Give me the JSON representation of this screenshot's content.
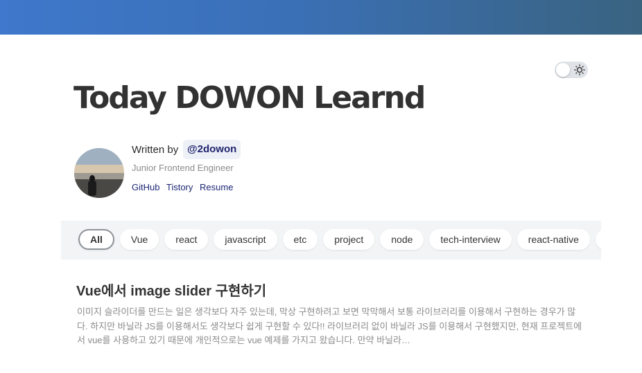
{
  "blog": {
    "title": "Today DOWON Learnd"
  },
  "author": {
    "written_by": "Written by",
    "handle": "@2dowon",
    "job": "Junior Frontend Engineer",
    "links": [
      {
        "label": "GitHub"
      },
      {
        "label": "Tistory"
      },
      {
        "label": "Resume"
      }
    ]
  },
  "theme_toggle": {
    "icon": "sun-icon",
    "state": "light"
  },
  "tags": [
    {
      "label": "All",
      "active": true
    },
    {
      "label": "Vue"
    },
    {
      "label": "react"
    },
    {
      "label": "javascript"
    },
    {
      "label": "etc"
    },
    {
      "label": "project"
    },
    {
      "label": "node"
    },
    {
      "label": "tech-interview"
    },
    {
      "label": "react-native"
    },
    {
      "label": ""
    }
  ],
  "posts": [
    {
      "title": "Vue에서 image slider 구현하기",
      "excerpt": "이미지 슬라이더를 만드는 일은 생각보다 자주 있는데, 막상 구현하려고 보면 막막해서 보통 라이브러리를 이용해서 구현하는 경우가 많다. 하지만 바닐라 JS를 이용해서도 생각보다 쉽게 구현할 수 있다!! 라이브러리 없이 바닐라 JS를 이용해서 구현했지만, 현재 프로젝트에서 vue를 사용하고 있기 때문에 개인적으로는 vue 예제를 가지고 왔습니다. 만약 바닐라…"
    }
  ],
  "colors": {
    "header_gradient_start": "#3f78cc",
    "header_gradient_end": "#3a6380",
    "link": "#1d2775",
    "handle_bg": "#edf0f7"
  }
}
